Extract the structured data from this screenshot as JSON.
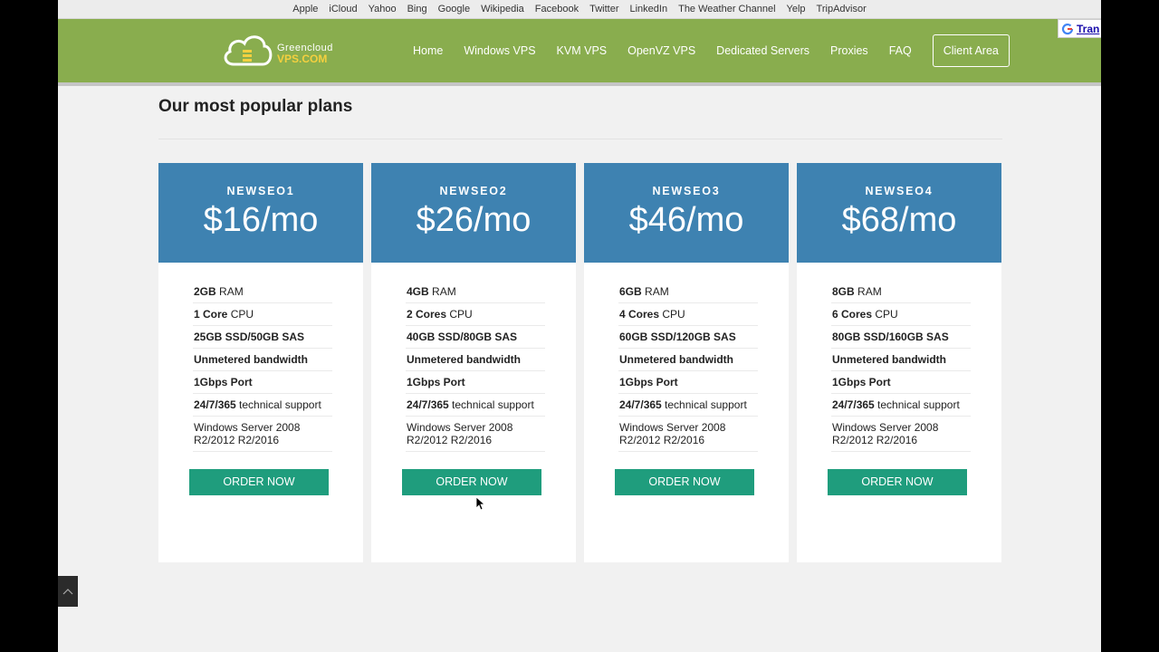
{
  "bookmarks": [
    "Apple",
    "iCloud",
    "Yahoo",
    "Bing",
    "Google",
    "Wikipedia",
    "Facebook",
    "Twitter",
    "LinkedIn",
    "The Weather Channel",
    "Yelp",
    "TripAdvisor"
  ],
  "logo": {
    "top": "Greencloud",
    "bottom": "VPS.COM"
  },
  "nav": [
    "Home",
    "Windows VPS",
    "KVM VPS",
    "OpenVZ VPS",
    "Dedicated Servers",
    "Proxies",
    "FAQ"
  ],
  "client_area": "Client Area",
  "translate": "Tran",
  "section_title": "Our most popular plans",
  "plans": [
    {
      "name": "NEWSEO1",
      "price": "$16/mo",
      "ram": "2GB",
      "cpu": "1 Core",
      "disk": "25GB SSD/50GB SAS"
    },
    {
      "name": "NEWSEO2",
      "price": "$26/mo",
      "ram": "4GB",
      "cpu": "2 Cores",
      "disk": "40GB SSD/80GB SAS"
    },
    {
      "name": "NEWSEO3",
      "price": "$46/mo",
      "ram": "6GB",
      "cpu": "4 Cores",
      "disk": "60GB SSD/120GB SAS"
    },
    {
      "name": "NEWSEO4",
      "price": "$68/mo",
      "ram": "8GB",
      "cpu": "6 Cores",
      "disk": "80GB SSD/160GB SAS"
    }
  ],
  "feature_labels": {
    "ram": " RAM",
    "cpu": " CPU",
    "bandwidth": "Unmetered bandwidth",
    "port": "1Gbps Port",
    "support_bold": "24/7/365",
    "support_rest": " technical support",
    "os": "Windows Server 2008 R2/2012 R2/2016"
  },
  "order_label": "ORDER NOW",
  "colors": {
    "header": "#89ad4e",
    "plan_head": "#3e82b1",
    "order_button": "#1f9d7d"
  }
}
